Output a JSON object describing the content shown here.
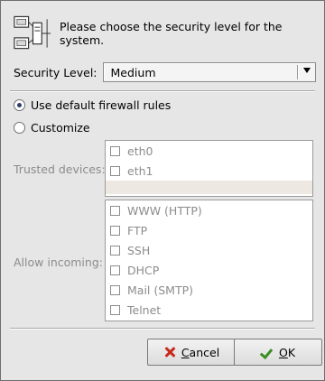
{
  "header": {
    "text": "Please choose the security level for the system."
  },
  "security_level": {
    "label": "Security Level:",
    "value": "Medium"
  },
  "firewall": {
    "default_label": "Use default firewall rules",
    "default_selected": true,
    "customize_label": "Customize",
    "customize_selected": false
  },
  "trusted_devices": {
    "label": "Trusted devices:",
    "items": [
      "eth0",
      "eth1"
    ]
  },
  "allow_incoming": {
    "label": "Allow incoming:",
    "items": [
      "WWW (HTTP)",
      "FTP",
      "SSH",
      "DHCP",
      "Mail (SMTP)",
      "Telnet"
    ]
  },
  "buttons": {
    "cancel": {
      "mnemonic": "C",
      "rest": "ancel"
    },
    "ok": {
      "mnemonic": "O",
      "rest": "K"
    }
  },
  "icons": {
    "network": "network-computers-icon",
    "cancel": "cancel-x-icon",
    "ok": "checkmark-icon",
    "select_arrow": "dropdown-arrow-icon"
  },
  "colors": {
    "background": "#e6e6e6",
    "radio_dot": "#2d3e6e",
    "cancel_x": "#c62b1c",
    "ok_check": "#3a8e22"
  }
}
